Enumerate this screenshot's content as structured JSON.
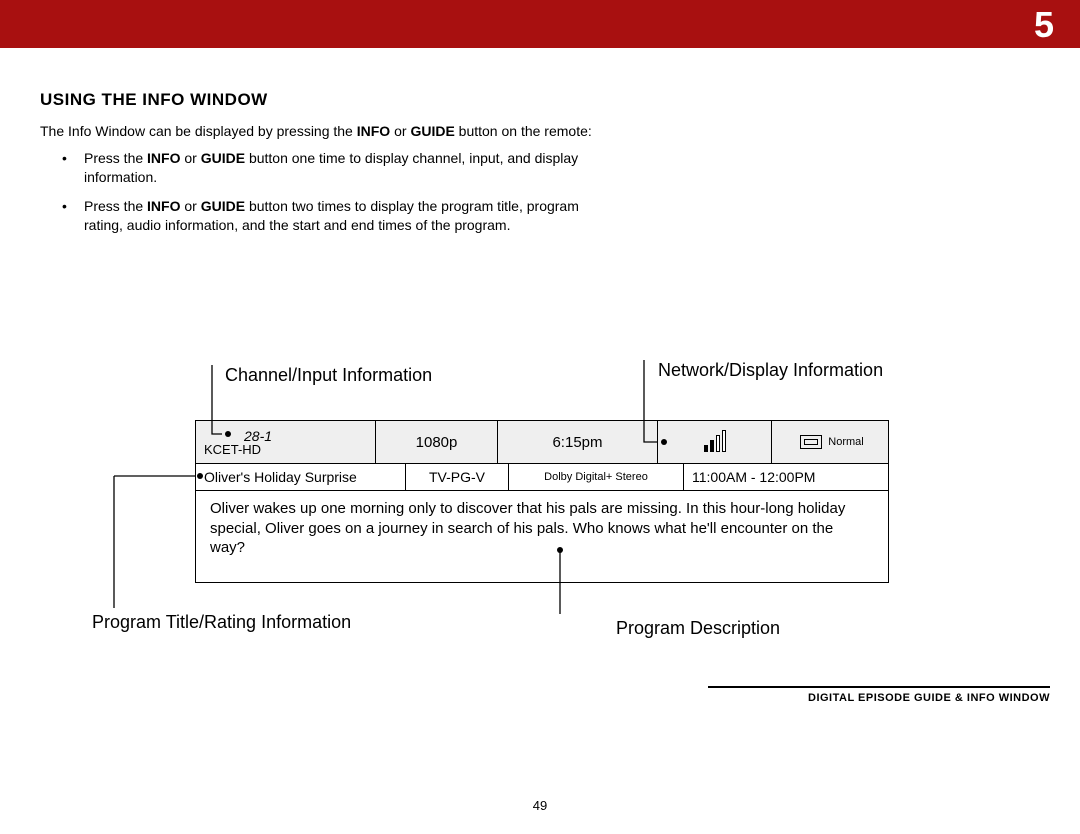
{
  "page": {
    "chapter_number": "5",
    "page_number": "49"
  },
  "section": {
    "title": "USING THE INFO WINDOW",
    "intro_pre": "The Info Window can be displayed by pressing the ",
    "intro_b1": "INFO",
    "intro_mid1": " or ",
    "intro_b2": "GUIDE",
    "intro_post": " button on the remote:",
    "bullet1_pre": "Press the ",
    "bullet1_b1": "INFO",
    "bullet1_mid": " or ",
    "bullet1_b2": "GUIDE",
    "bullet1_post": " button one time to display channel, input, and display information.",
    "bullet2_pre": "Press the ",
    "bullet2_b1": "INFO",
    "bullet2_mid": " or ",
    "bullet2_b2": "GUIDE",
    "bullet2_post": " button two times to display the program title, program rating, audio information, and the start and end times of the program."
  },
  "callouts": {
    "channel_input": "Channel/Input Information",
    "network_display": "Network/Display Information",
    "program_title_rating": "Program Title/Rating Information",
    "program_description": "Program Description"
  },
  "info_window": {
    "row1": {
      "channel_number": "28-1",
      "channel_name": "KCET-HD",
      "resolution": "1080p",
      "time": "6:15pm",
      "aspect_label": "Normal"
    },
    "row2": {
      "program_title": "Oliver's Holiday Surprise",
      "rating": "TV-PG-V",
      "audio": "Dolby Digital+ Stereo",
      "time_range": "11:00AM - 12:00PM"
    },
    "description": "Oliver wakes up one morning only to discover that his pals are missing. In this hour-long holiday special, Oliver goes on a journey in search of his pals. Who knows what he'll encounter on the way?"
  },
  "footer": {
    "tag": "DIGITAL EPISODE GUIDE & INFO WINDOW"
  }
}
